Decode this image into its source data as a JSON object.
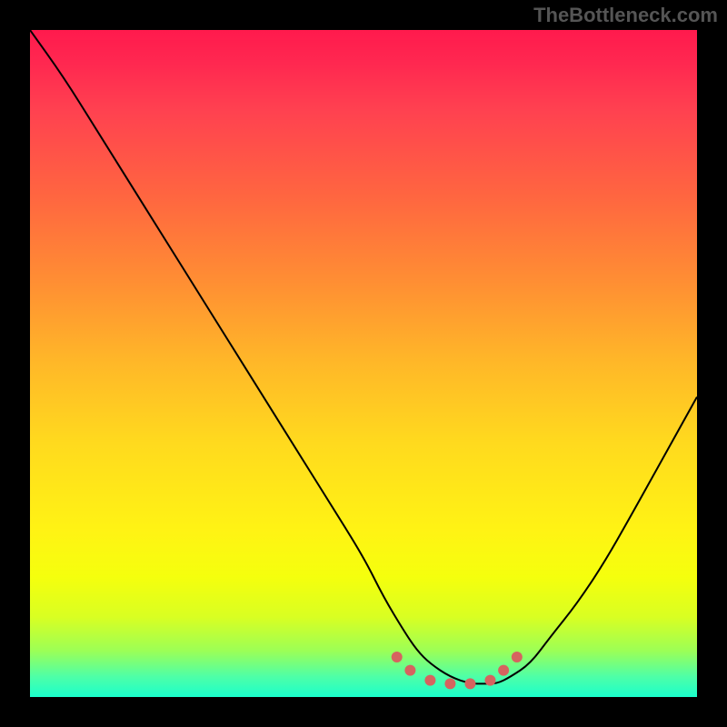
{
  "watermark": "TheBottleneck.com",
  "chart_data": {
    "type": "line",
    "title": "",
    "xlabel": "",
    "ylabel": "",
    "xlim": [
      0,
      100
    ],
    "ylim": [
      0,
      100
    ],
    "series": [
      {
        "name": "bottleneck-curve",
        "x": [
          0,
          5,
          10,
          15,
          20,
          25,
          30,
          35,
          40,
          45,
          50,
          53,
          56,
          58,
          60,
          63,
          66,
          68,
          70,
          72,
          75,
          78,
          82,
          86,
          90,
          95,
          100
        ],
        "y": [
          100,
          93,
          85,
          77,
          69,
          61,
          53,
          45,
          37,
          29,
          21,
          15,
          10,
          7,
          5,
          3,
          2,
          2,
          2,
          3,
          5,
          9,
          14,
          20,
          27,
          36,
          45
        ]
      }
    ],
    "optimal_zone": {
      "points": [
        {
          "x": 55,
          "y": 6
        },
        {
          "x": 57,
          "y": 4
        },
        {
          "x": 60,
          "y": 2.5
        },
        {
          "x": 63,
          "y": 2
        },
        {
          "x": 66,
          "y": 2
        },
        {
          "x": 69,
          "y": 2.5
        },
        {
          "x": 71,
          "y": 4
        },
        {
          "x": 73,
          "y": 6
        }
      ]
    }
  }
}
